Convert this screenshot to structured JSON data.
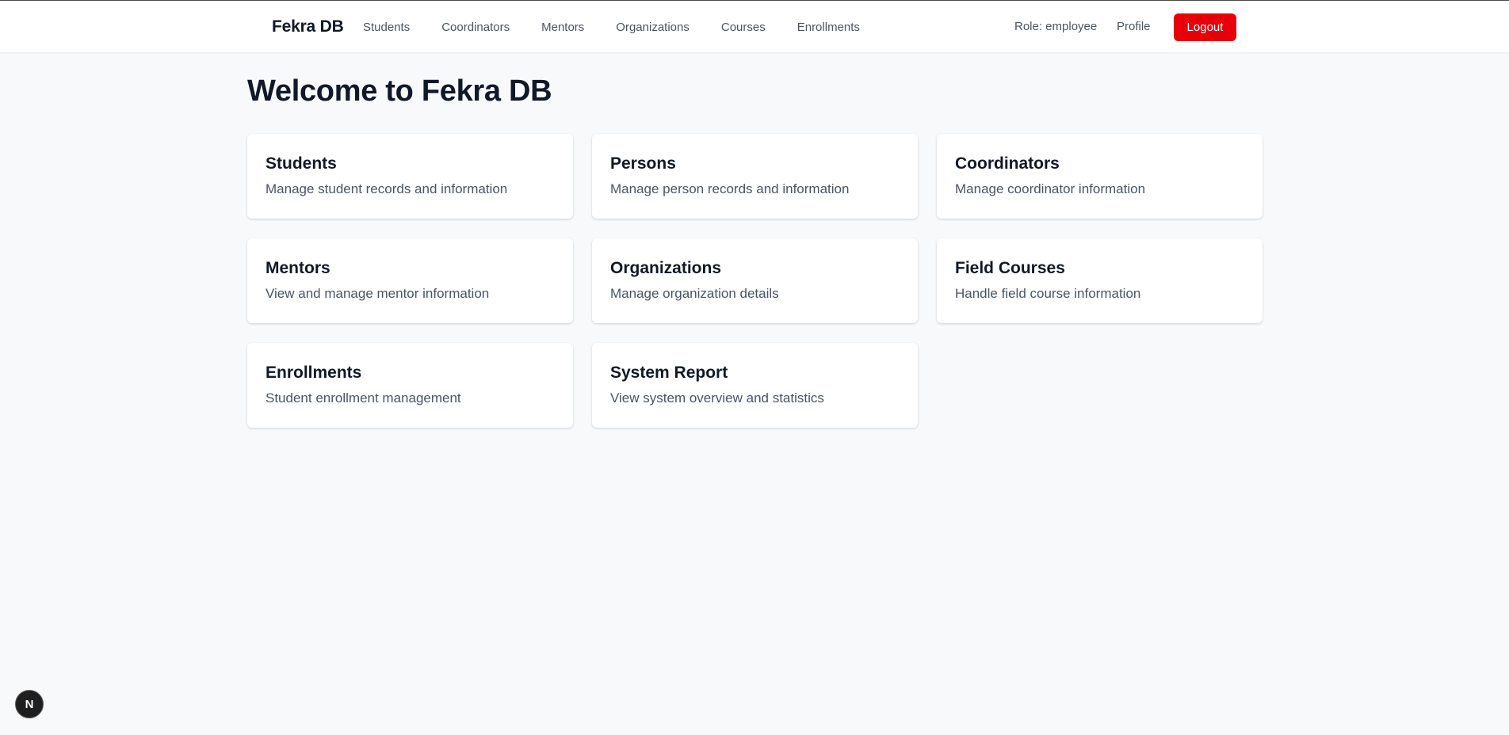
{
  "header": {
    "brand": "Fekra DB",
    "nav": [
      {
        "label": "Students"
      },
      {
        "label": "Coordinators"
      },
      {
        "label": "Mentors"
      },
      {
        "label": "Organizations"
      },
      {
        "label": "Courses"
      },
      {
        "label": "Enrollments"
      }
    ],
    "role": "Role: employee",
    "profile": "Profile",
    "logout": "Logout",
    "logout_color": "#e7000b"
  },
  "main": {
    "title": "Welcome to Fekra DB",
    "cards": [
      {
        "title": "Students",
        "description": "Manage student records and information"
      },
      {
        "title": "Persons",
        "description": "Manage person records and information"
      },
      {
        "title": "Coordinators",
        "description": "Manage coordinator information"
      },
      {
        "title": "Mentors",
        "description": "View and manage mentor information"
      },
      {
        "title": "Organizations",
        "description": "Manage organization details"
      },
      {
        "title": "Field Courses",
        "description": "Handle field course information"
      },
      {
        "title": "Enrollments",
        "description": "Student enrollment management"
      },
      {
        "title": "System Report",
        "description": "View system overview and statistics"
      }
    ]
  },
  "dev_badge": {
    "glyph": "N",
    "icon": "nextjs-dev-indicator-icon"
  }
}
